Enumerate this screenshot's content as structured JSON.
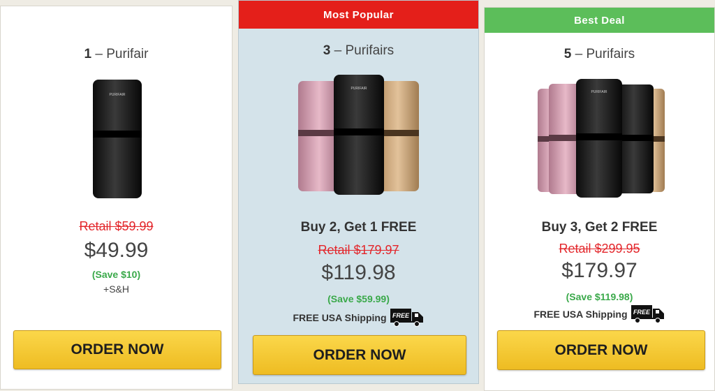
{
  "offers": [
    {
      "banner": "",
      "quantity_number": "1",
      "quantity_label": "– Purifair",
      "deal": "",
      "retail": "Retail $59.99",
      "price": "$49.99",
      "save": "(Save $10)",
      "shipping_note": "+S&H",
      "order_button": "ORDER NOW",
      "product_colors": [
        "black"
      ]
    },
    {
      "banner": "Most Popular",
      "quantity_number": "3",
      "quantity_label": "– Purifairs",
      "deal": "Buy 2, Get 1 FREE",
      "retail": "Retail $179.97",
      "price": "$119.98",
      "save": "(Save $59.99)",
      "shipping_note": "FREE USA Shipping",
      "free_truck_label": "FREE",
      "order_button": "ORDER NOW",
      "product_colors": [
        "pink",
        "black",
        "gold"
      ]
    },
    {
      "banner": "Best Deal",
      "quantity_number": "5",
      "quantity_label": "– Purifairs",
      "deal": "Buy 3, Get 2 FREE",
      "retail": "Retail $299.95",
      "price": "$179.97",
      "save": "(Save $119.98)",
      "shipping_note": "FREE USA Shipping",
      "free_truck_label": "FREE",
      "order_button": "ORDER NOW",
      "product_colors": [
        "pink",
        "pink",
        "black",
        "black",
        "gold"
      ]
    }
  ],
  "product_brand": "PURIFAIR",
  "colors": {
    "banner_popular": "#e41f1a",
    "banner_best": "#5cbe5a",
    "retail_strike": "#e3262b",
    "save_green": "#3aa94a",
    "button_yellow": "#f5c93a"
  }
}
